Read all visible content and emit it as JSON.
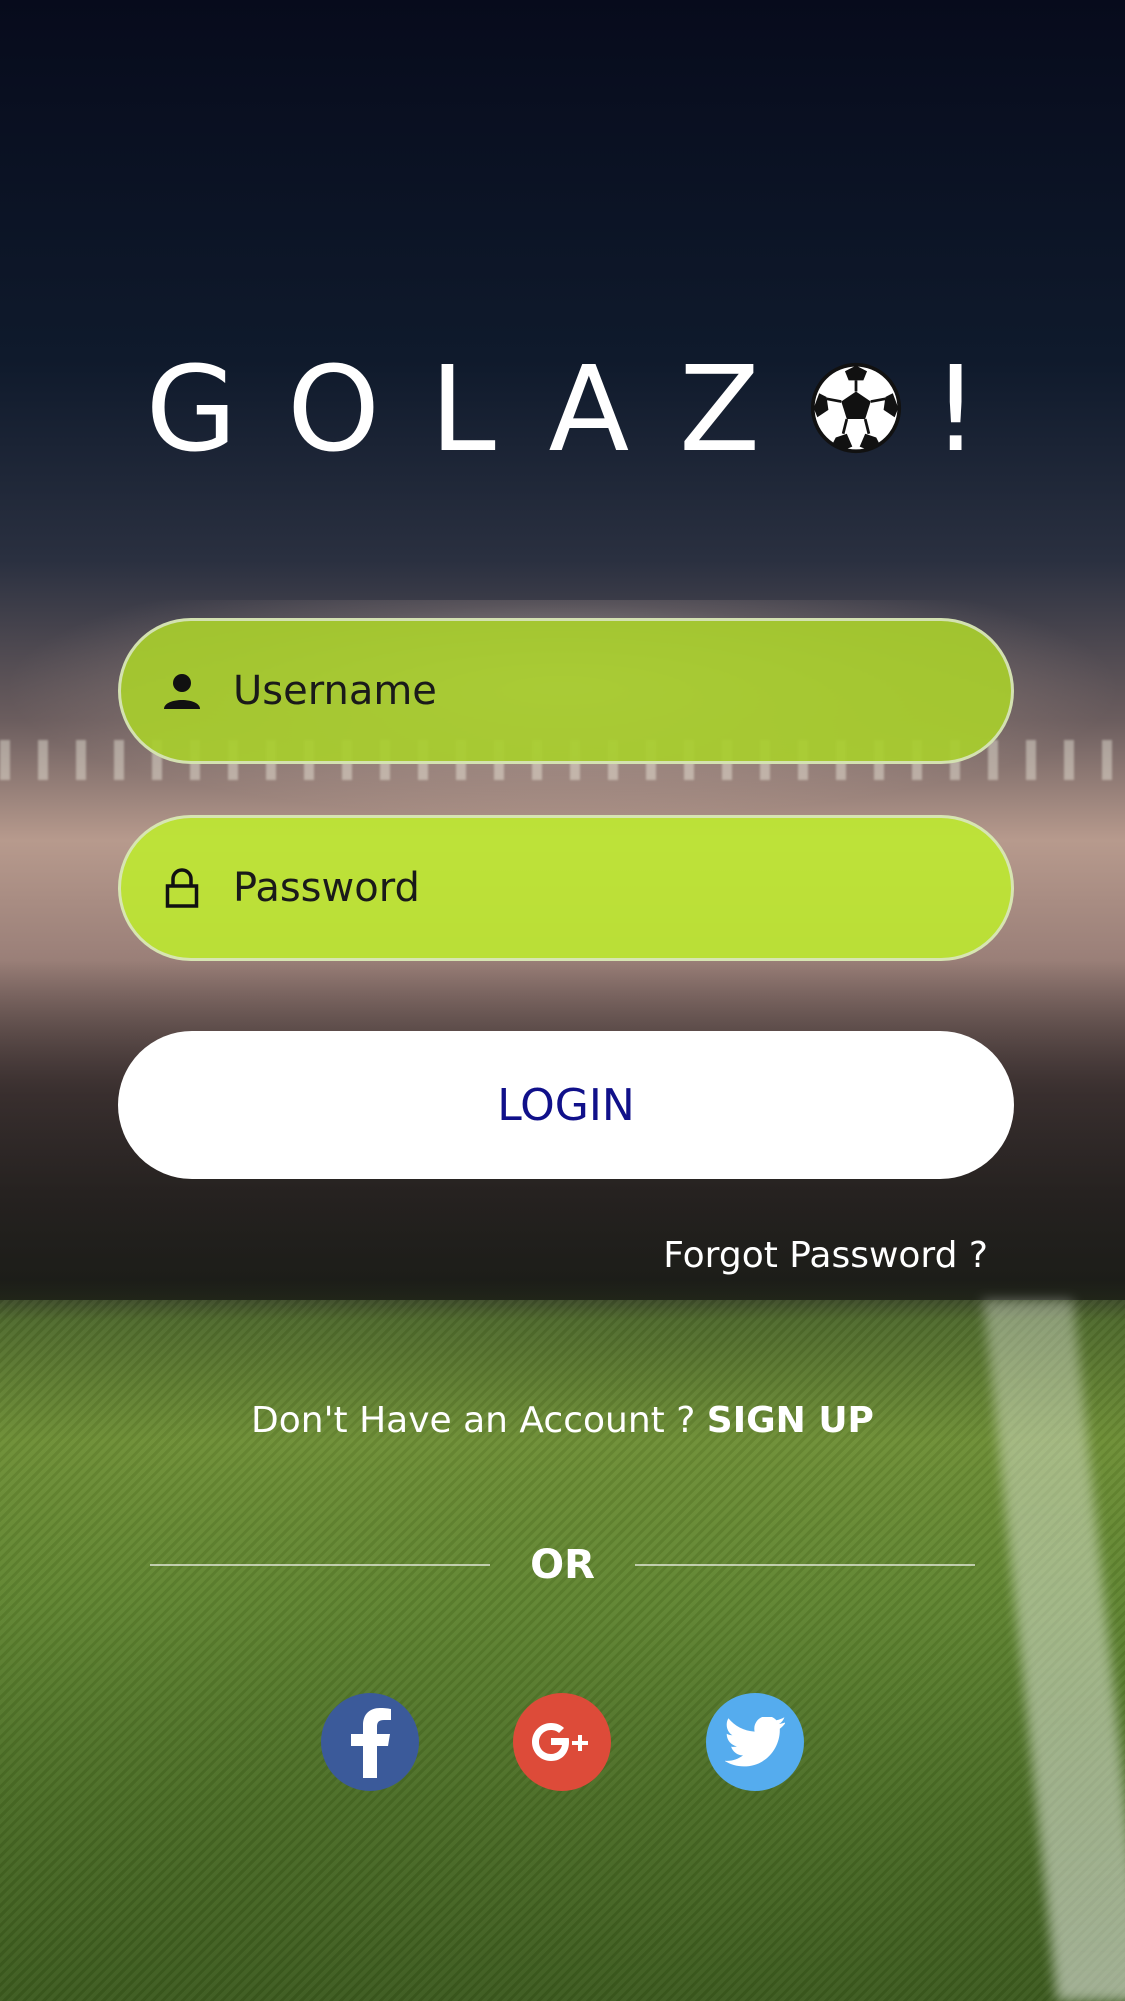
{
  "app": {
    "logo_text": "GOLAZ",
    "logo_excl": "!"
  },
  "form": {
    "username_placeholder": "Username",
    "username_value": "",
    "password_placeholder": "Password",
    "password_value": "",
    "login_label": "LOGIN",
    "forgot_label": "Forgot Password ?"
  },
  "signup": {
    "prompt": "Don't Have an Account ?",
    "link_label": "SIGN UP"
  },
  "divider": {
    "label": "OR"
  },
  "social": [
    {
      "name": "facebook",
      "icon": "facebook-icon",
      "color": "#3b5a9a"
    },
    {
      "name": "google-plus",
      "icon": "google-plus-icon",
      "color": "#dd4b39"
    },
    {
      "name": "twitter",
      "icon": "twitter-icon",
      "color": "#55acee"
    }
  ],
  "colors": {
    "field_green": "#a8ce2c",
    "login_text": "#10108a"
  }
}
